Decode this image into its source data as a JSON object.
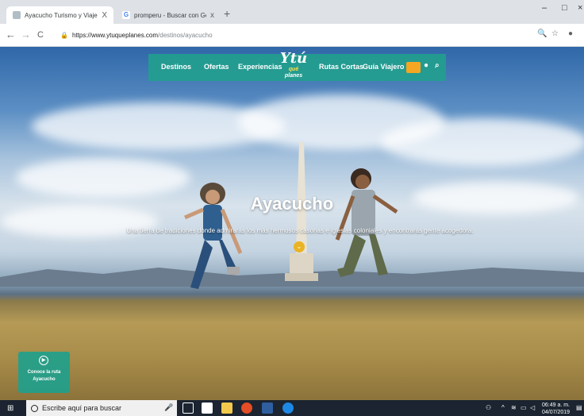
{
  "browser": {
    "tabs": [
      {
        "title": "Ayacucho Turismo y Viajes en Su",
        "close": "X",
        "active": true
      },
      {
        "title": "promperu - Buscar con Google",
        "close": "x",
        "active": false
      }
    ],
    "new_tab": "+",
    "window_controls": {
      "minimize": "–",
      "maximize": "□",
      "close": "×"
    },
    "nav": {
      "back": "←",
      "forward": "→",
      "reload": "C"
    },
    "url_host": "https://www.ytuqueplanes.com",
    "url_path": "/destinos/ayacucho"
  },
  "site": {
    "nav_items": [
      "Destinos",
      "Ofertas",
      "Experiencias",
      "Rutas Cortas",
      "Guía Viajero"
    ],
    "logo_main": "Ytú",
    "logo_que": "qué",
    "logo_planes": "planes",
    "colors": {
      "nav_bg": "#21a08c",
      "accent": "#f5a623",
      "scroll_btn": "#e9b323"
    }
  },
  "hero": {
    "title": "Ayacucho",
    "subtitle": "Una tierra de tradiciones donde admirarás los más hermosos casonas e iglesias coloniales y encontrarás gente acogedora."
  },
  "route_card": {
    "label_line1": "Conoce la ruta",
    "label_line2": "Ayacucho"
  },
  "taskbar": {
    "search_placeholder": "Escribe aquí para buscar",
    "time": "06:49 a. m.",
    "date": "04/07/2019"
  }
}
